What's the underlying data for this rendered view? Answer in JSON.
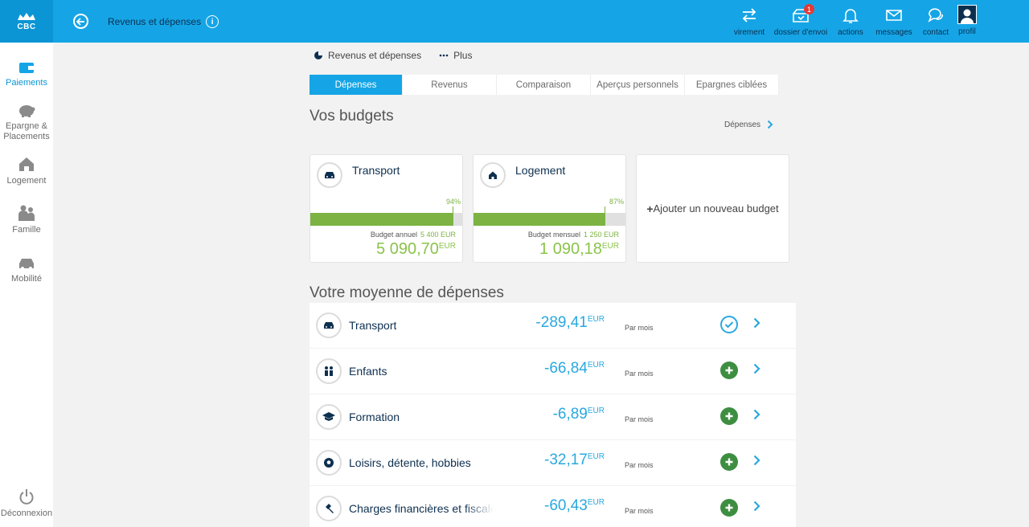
{
  "header": {
    "logo": "CBC",
    "title": "Revenus et dépenses",
    "actions": [
      {
        "label": "virement",
        "icon": "transfer-icon"
      },
      {
        "label": "dossier d'envoi",
        "icon": "outbox-icon",
        "badge": "1"
      },
      {
        "label": "actions",
        "icon": "bell-icon"
      },
      {
        "label": "messages",
        "icon": "envelope-icon"
      },
      {
        "label": "contact",
        "icon": "chat-icon"
      }
    ],
    "profile_label": "profil"
  },
  "sidebar": {
    "items": [
      {
        "label": "Paiements",
        "icon": "wallet-icon",
        "active": true
      },
      {
        "label": "Epargne & Placements",
        "icon": "piggy-bank-icon"
      },
      {
        "label": "Logement",
        "icon": "house-icon"
      },
      {
        "label": "Famille",
        "icon": "family-icon"
      },
      {
        "label": "Mobilité",
        "icon": "car-icon"
      }
    ],
    "logout_label": "Déconnexion"
  },
  "subnav": {
    "overview": "Revenus et dépenses",
    "more": "Plus"
  },
  "tabs": [
    "Dépenses",
    "Revenus",
    "Comparaison",
    "Aperçus personnels",
    "Epargnes ciblées"
  ],
  "budgets": {
    "title": "Vos budgets",
    "link": "Dépenses",
    "cards": [
      {
        "name": "Transport",
        "percent": "94%",
        "fill": 0.94,
        "budget_label": "Budget annuel",
        "budget_amount": "5 400 EUR",
        "spent": "5 090,70",
        "currency": "EUR"
      },
      {
        "name": "Logement",
        "percent": "87%",
        "fill": 0.87,
        "budget_label": "Budget mensuel",
        "budget_amount": "1 250 EUR",
        "spent": "1 090,18",
        "currency": "EUR"
      }
    ],
    "add_label": "Ajouter un nouveau budget"
  },
  "average": {
    "title": "Votre moyenne de dépenses",
    "period_label": "Par mois",
    "rows": [
      {
        "name": "Transport",
        "amount": "-289,41",
        "currency": "EUR",
        "status": "check"
      },
      {
        "name": "Enfants",
        "amount": "-66,84",
        "currency": "EUR",
        "status": "add"
      },
      {
        "name": "Formation",
        "amount": "-6,89",
        "currency": "EUR",
        "status": "add"
      },
      {
        "name": "Loisirs, détente, hobbies",
        "amount": "-32,17",
        "currency": "EUR",
        "status": "add"
      },
      {
        "name": "Charges financières et fiscales",
        "amount": "-60,43",
        "currency": "EUR",
        "status": "add"
      }
    ]
  },
  "colors": {
    "primary": "#15a5e6",
    "navy": "#0d2f4f",
    "green": "#7cb342",
    "add_green": "#3e8e41"
  }
}
